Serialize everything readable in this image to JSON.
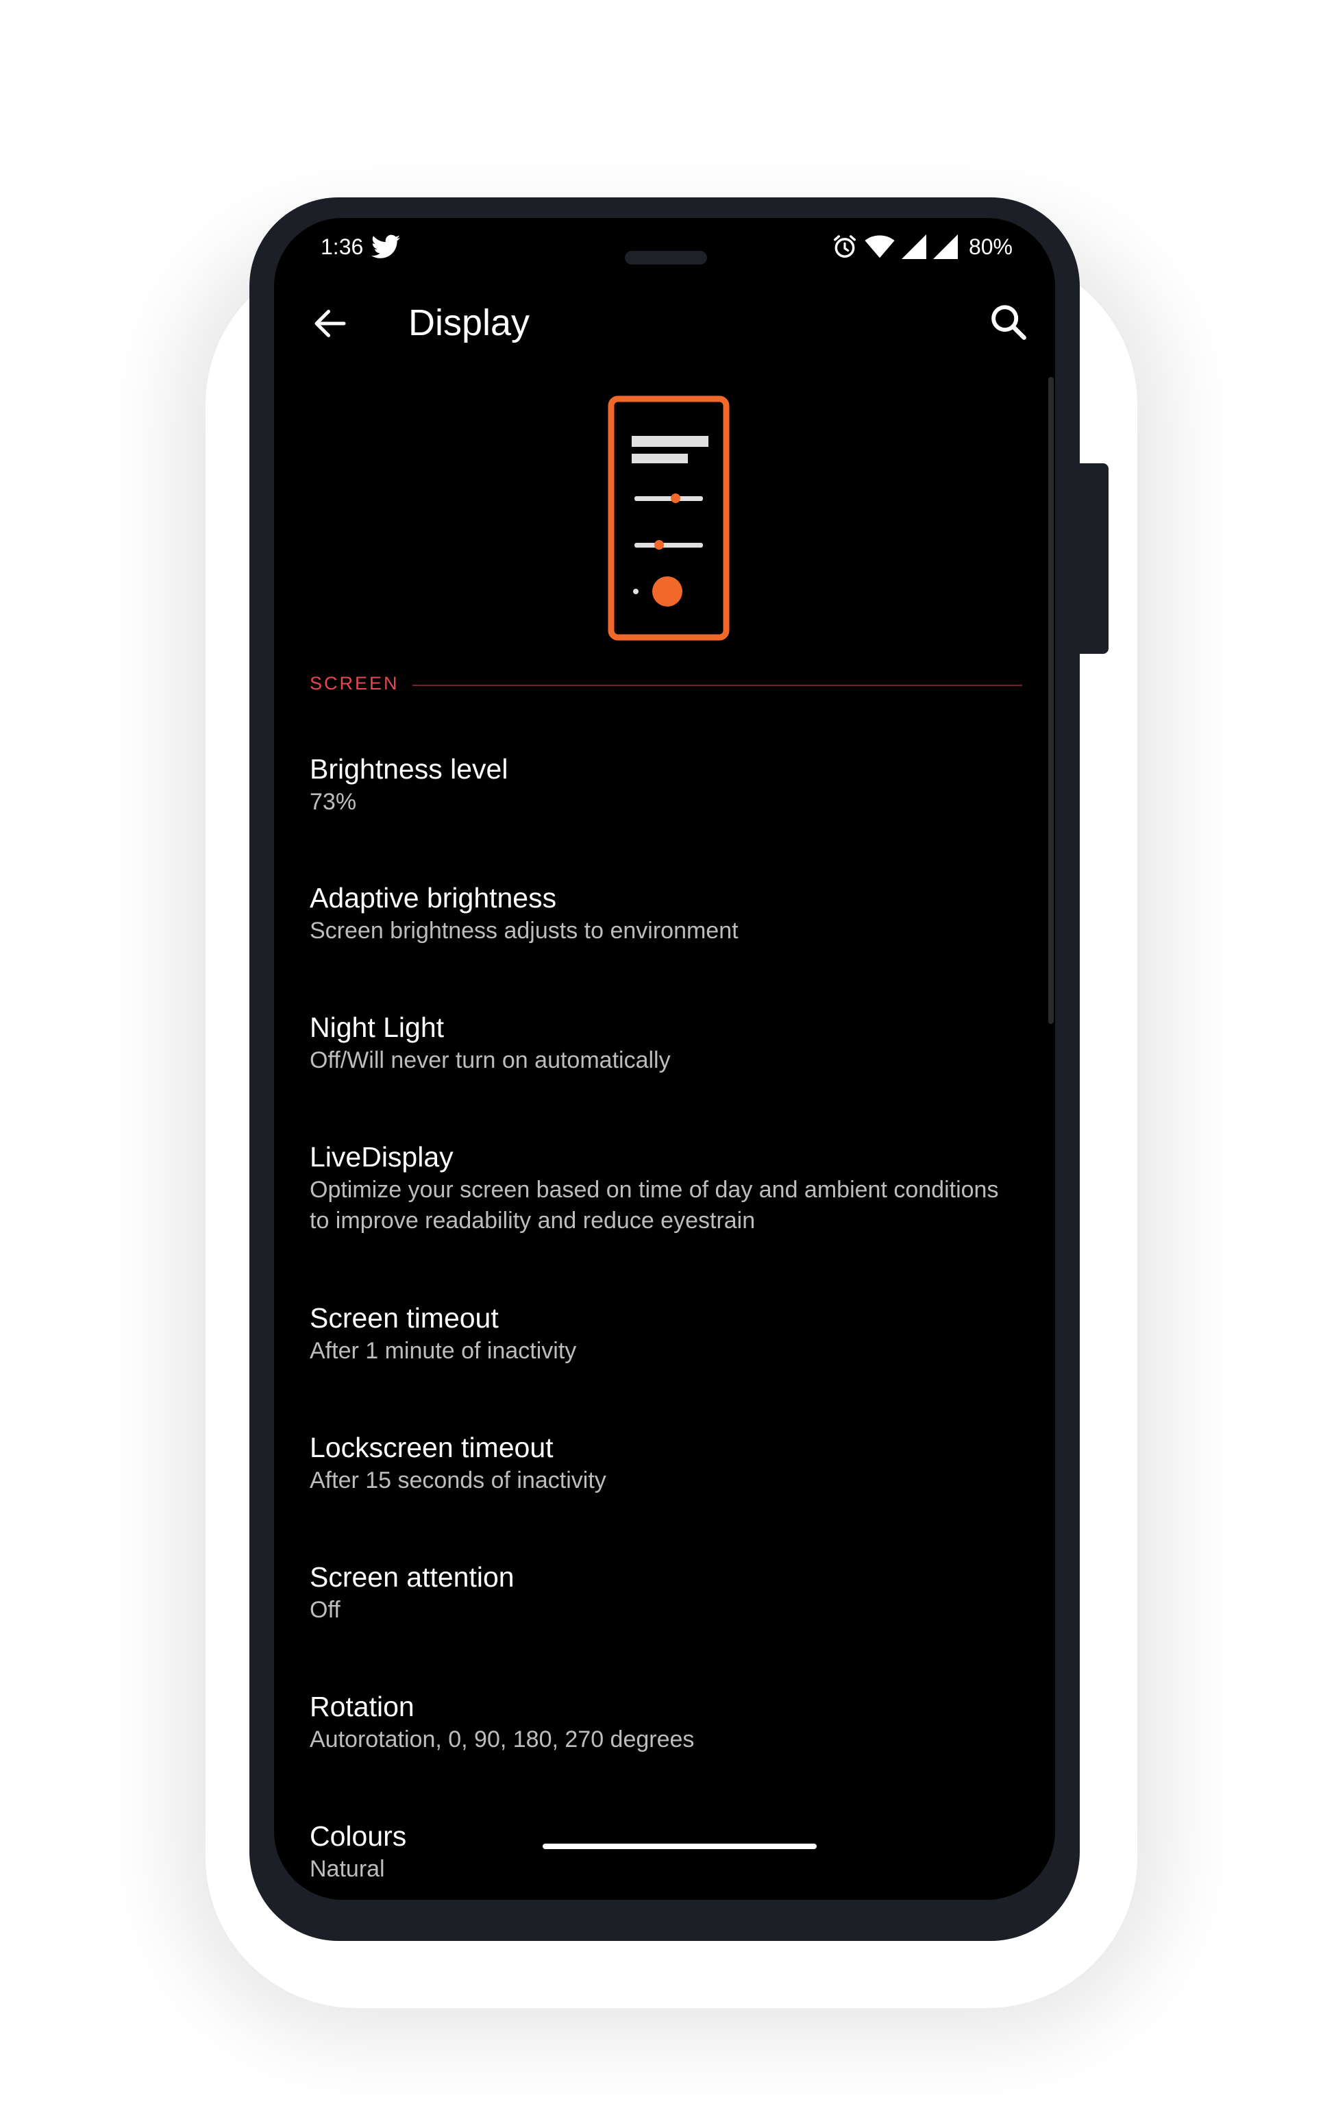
{
  "status_bar": {
    "time": "1:36",
    "battery": "80%",
    "icons": [
      "twitter-icon",
      "alarm-icon",
      "wifi-icon",
      "signal-icon",
      "signal-icon"
    ]
  },
  "app_bar": {
    "title": "Display",
    "back_icon": "arrow-left-icon",
    "search_icon": "search-icon"
  },
  "colors": {
    "accent": "#f0692a",
    "section_header": "#e5484d",
    "background": "#000000"
  },
  "section": {
    "label": "SCREEN"
  },
  "items": [
    {
      "title": "Brightness level",
      "summary": "73%"
    },
    {
      "title": "Adaptive brightness",
      "summary": "Screen brightness adjusts to environment"
    },
    {
      "title": "Night Light",
      "summary": "Off/Will never turn on automatically"
    },
    {
      "title": "LiveDisplay",
      "summary": "Optimize your screen based on time of day and ambient conditions to improve readability and reduce eyestrain"
    },
    {
      "title": "Screen timeout",
      "summary": "After 1 minute of inactivity"
    },
    {
      "title": "Lockscreen timeout",
      "summary": "After 15 seconds of inactivity"
    },
    {
      "title": "Screen attention",
      "summary": "Off"
    },
    {
      "title": "Rotation",
      "summary": "Autorotation, 0, 90, 180, 270 degrees"
    },
    {
      "title": "Colours",
      "summary": "Natural"
    }
  ]
}
